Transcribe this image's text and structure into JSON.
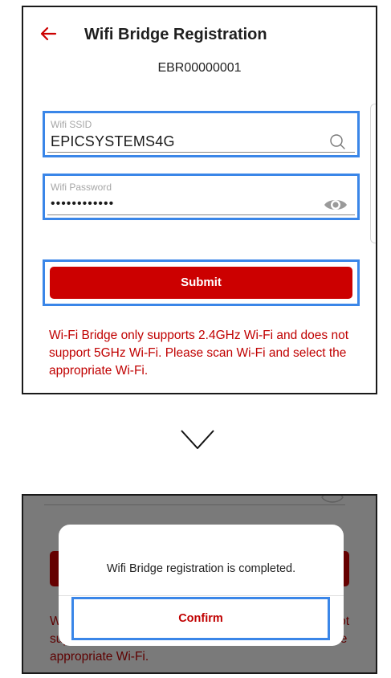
{
  "screen1": {
    "title": "Wifi Bridge Registration",
    "device_id": "EBR00000001",
    "ssid": {
      "label": "Wifi SSID",
      "value": "EPICSYSTEMS4G",
      "icon": "search-icon"
    },
    "password": {
      "label": "Wifi Password",
      "value": "••••••••••••",
      "icon": "eye-icon"
    },
    "submit_label": "Submit",
    "notice": "Wi-Fi Bridge only supports 2.4GHz Wi-Fi and does not support 5GHz Wi-Fi. Please scan Wi-Fi and select the appropriate Wi-Fi."
  },
  "transition_icon": "chevron-down-icon",
  "screen2": {
    "background_notice": "Wi-Fi Bridge only supports 2.4GHz Wi-Fi and does not support 5GHz Wi-Fi. Please scan Wi-Fi and select the appropriate Wi-Fi.",
    "dialog": {
      "message": "Wifi Bridge registration is completed.",
      "confirm_label": "Confirm"
    }
  },
  "colors": {
    "brand_red": "#cc0000",
    "highlight_blue": "#3a86e8",
    "overlay_gray": "#7a7a7a"
  }
}
